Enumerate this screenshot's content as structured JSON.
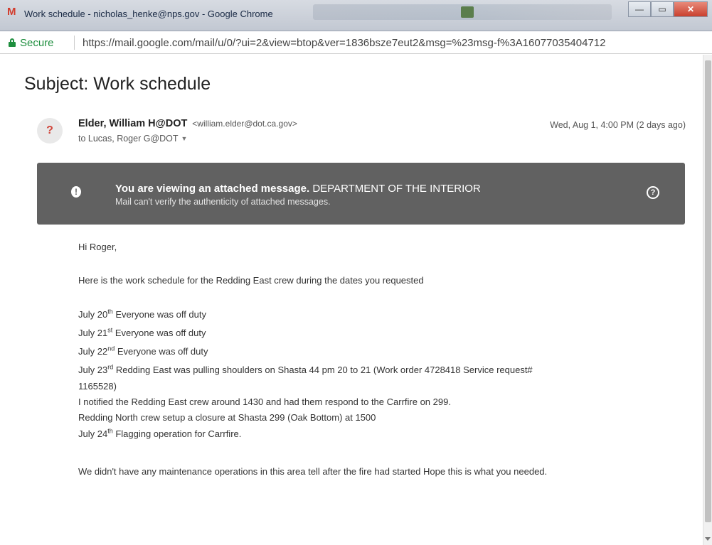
{
  "window": {
    "title": "Work schedule - nicholas_henke@nps.gov - Google Chrome",
    "logo_glyph": "M",
    "controls": {
      "minimize": "—",
      "maximize": "▭",
      "close": "✕"
    }
  },
  "address_bar": {
    "secure_label": "Secure",
    "url": "https://mail.google.com/mail/u/0/?ui=2&view=btop&ver=1836bsze7eut2&msg=%23msg-f%3A16077035404712"
  },
  "email": {
    "subject": "Subject: Work schedule",
    "avatar_glyph": "?",
    "sender_name": "Elder, William H@DOT",
    "sender_email": "<william.elder@dot.ca.gov>",
    "to_line": "to Lucas, Roger G@DOT",
    "date": "Wed, Aug 1, 4:00 PM (2 days ago)"
  },
  "banner": {
    "line1_strong": "You are viewing an attached message.",
    "line1_rest": " DEPARTMENT OF THE INTERIOR",
    "line2": "Mail can't verify the authenticity of attached messages.",
    "alert_glyph": "!",
    "help_glyph": "?"
  },
  "body": {
    "greeting": "Hi Roger,",
    "intro": "Here is the work schedule for the Redding East crew during the dates you requested",
    "schedule": [
      {
        "day": "July 20",
        "suffix": "th",
        "text": " Everyone was off duty"
      },
      {
        "day": "July 21",
        "suffix": "st",
        "text": " Everyone was off duty"
      },
      {
        "day": "July 22",
        "suffix": "nd",
        "text": " Everyone was off duty"
      },
      {
        "day": "July 23",
        "suffix": "rd",
        "text": " Redding East was pulling shoulders on Shasta 44 pm 20 to 21  (Work order 4728418  Service request#"
      }
    ],
    "continuation": "1165528)",
    "line_notified": "I notified the Redding East crew around 1430 and had them respond to the Carrfire on 299.",
    "line_north": "Redding North crew setup a closure at Shasta 299 (Oak Bottom) at 1500",
    "july24": {
      "day": "July 24",
      "suffix": "th",
      "text": " Flagging operation for Carrfire."
    },
    "closing": "We didn't have any maintenance operations in this area tell after the fire had started  Hope this is what you needed."
  }
}
